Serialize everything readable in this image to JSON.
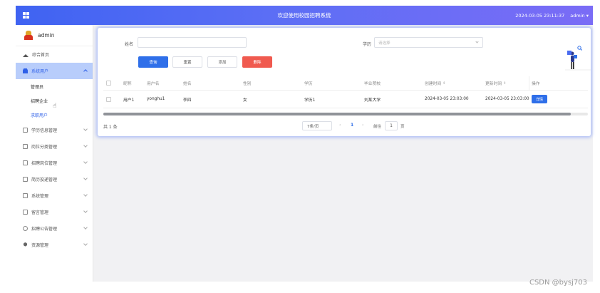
{
  "header": {
    "title": "欢迎使用校园招聘系统",
    "datetime": "2024-03-05 23:11:37",
    "user": "admin",
    "user_caret": "▾"
  },
  "sidebar": {
    "username": "admin",
    "items": [
      {
        "label": "综合首页",
        "icon": "home-icon"
      },
      {
        "label": "系统用户",
        "icon": "user-icon",
        "expanded": true,
        "children": [
          {
            "label": "管理员"
          },
          {
            "label": "招聘企业"
          },
          {
            "label": "求职用户",
            "current": true
          }
        ]
      },
      {
        "label": "学历信息管理",
        "icon": "square-icon"
      },
      {
        "label": "岗位分类管理",
        "icon": "square-icon"
      },
      {
        "label": "招聘岗位管理",
        "icon": "square-icon"
      },
      {
        "label": "简历投递管理",
        "icon": "square-icon"
      },
      {
        "label": "系统管理",
        "icon": "square-icon"
      },
      {
        "label": "留言管理",
        "icon": "square-icon"
      },
      {
        "label": "招聘公告管理",
        "icon": "info-icon"
      },
      {
        "label": "资源管理",
        "icon": "pin-icon"
      }
    ]
  },
  "search": {
    "name_label": "姓名",
    "name_value": "",
    "edu_label": "学历",
    "edu_placeholder": "请选择"
  },
  "toolbar": {
    "search": "查询",
    "reset": "重置",
    "add": "添加",
    "delete": "删除"
  },
  "table": {
    "columns": [
      "昵称",
      "用户名",
      "姓名",
      "性别",
      "学历",
      "毕业院校",
      "创建时间",
      "更新时间",
      "操作"
    ],
    "sort_mark": "⇕",
    "rows": [
      {
        "nickname": "用户1",
        "username": "yonghu1",
        "name": "李四",
        "gender": "女",
        "education": "学历1",
        "school": "刘某大学",
        "created": "2024-03-05 23:03:00",
        "updated": "2024-03-05 23:03:00",
        "action": "详情"
      }
    ]
  },
  "pagination": {
    "total": "共 1 条",
    "page_size": "7条/页",
    "current_page": "1",
    "goto_label": "前往",
    "goto_value": "1",
    "page_unit": "页",
    "prev": "‹",
    "next": "›"
  },
  "watermark": "CSDN @bysj703",
  "colors": {
    "primary": "#2f6fe9",
    "danger": "#f05a4f",
    "header_start": "#3f63f2",
    "header_end": "#7a6cf6",
    "active_menu_bg": "#b8cdfb"
  }
}
